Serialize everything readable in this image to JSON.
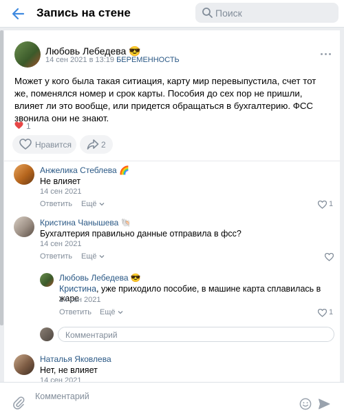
{
  "header": {
    "title": "Запись на стене",
    "search_placeholder": "Поиск"
  },
  "post": {
    "author": "Любовь Лебедева 😎",
    "date": "14 сен 2021 в 13:19",
    "date_sep": " в ",
    "group": "БЕРЕМЕННОСТЬ",
    "text": "Может у кого была такая ситиация, карту мир перевыпустила, счет тот же, поменялся номер и срок карты. Пособия до сех пор не пришли, влияет ли это вообще, или придется обращаться в бухгалтерию. ФСС звонила они не знают.",
    "likes_count": "1",
    "like_label": "Нравится",
    "shares_count": "2"
  },
  "comments": [
    {
      "name": "Анжелика Стеблева 🌈",
      "text": "Не влияет",
      "date": "14 сен 2021",
      "reply": "Ответить",
      "more": "Ещё",
      "likes": "1"
    },
    {
      "name": "Кристина Чанышева 🐚",
      "text": "Бухгалтерия правильно данные отправила в фсс?",
      "date": "14 сен 2021",
      "reply": "Ответить",
      "more": "Ещё",
      "likes": ""
    },
    {
      "name": "Любовь Лебедева 😎",
      "mention": "Кристина",
      "text": ", уже приходило пособие, в машине карта сплавилась в жаре",
      "date": "14 сен 2021",
      "reply": "Ответить",
      "more": "Ещё",
      "likes": "1"
    },
    {
      "name": "Наталья Яковлева",
      "text": "Нет, не влияет",
      "date": "14 сен 2021"
    }
  ],
  "reply_input": {
    "placeholder": "Комментарий"
  },
  "footer": {
    "placeholder": "Комментарий"
  },
  "colors": {
    "link": "#2a5885",
    "accent": "#3f8ae0",
    "heart": "#e64646",
    "muted": "#818c99"
  },
  "icons": [
    "back-arrow-icon",
    "search-icon",
    "more-icon",
    "heart-icon",
    "share-icon",
    "chevron-down-icon",
    "attach-icon",
    "smile-icon",
    "send-icon"
  ]
}
